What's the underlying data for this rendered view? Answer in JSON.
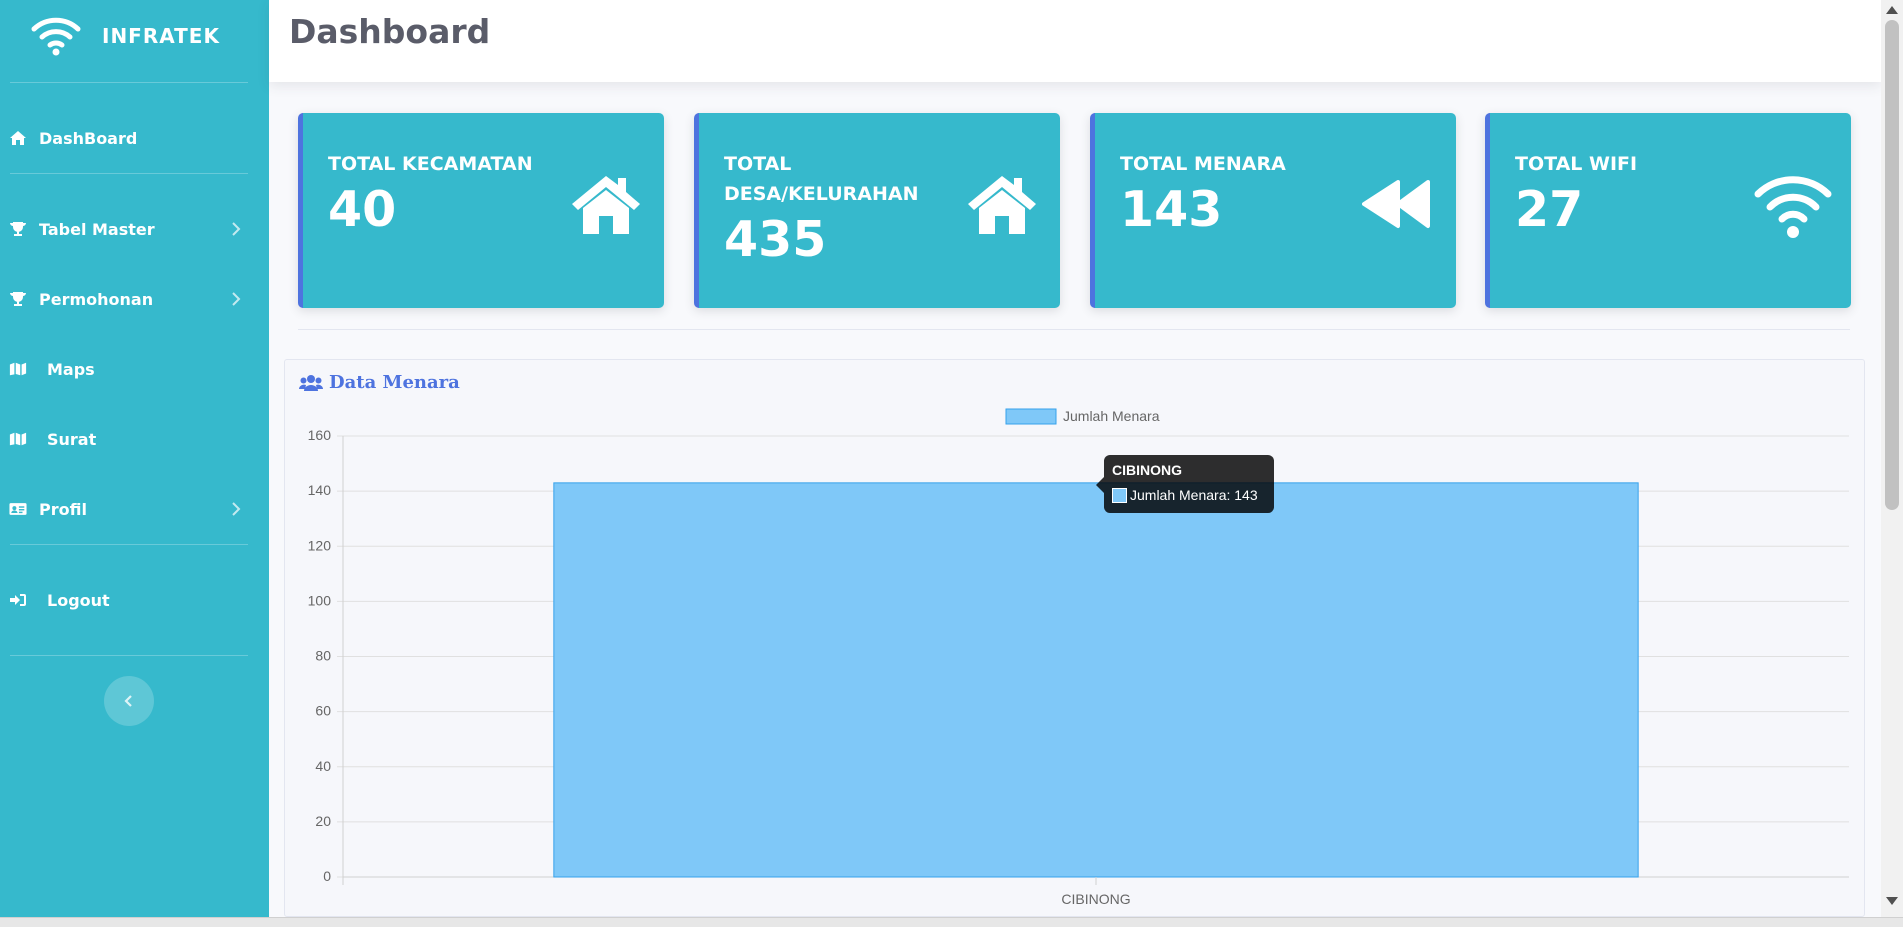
{
  "brand": {
    "name": "INFRATEK",
    "icon": "wifi-icon"
  },
  "sidebar": {
    "items": [
      {
        "label": "DashBoard",
        "icon": "home-icon"
      },
      {
        "label": "Tabel Master",
        "icon": "trophy-icon"
      },
      {
        "label": "Permohonan",
        "icon": "trophy-icon"
      },
      {
        "label": "Maps",
        "icon": "map-icon"
      },
      {
        "label": "Surat",
        "icon": "map-icon"
      },
      {
        "label": "Profil",
        "icon": "id-card-icon"
      },
      {
        "label": "Logout",
        "icon": "sign-out-icon"
      }
    ],
    "toggle_icon": "chevron-left-icon"
  },
  "header": {
    "title": "Dashboard"
  },
  "cards": [
    {
      "title": "TOTAL KECAMATAN",
      "value": "40",
      "icon": "home-icon"
    },
    {
      "title": "TOTAL DESA/KELURAHAN",
      "value": "435",
      "icon": "home-icon"
    },
    {
      "title": "TOTAL MENARA",
      "value": "143",
      "icon": "backward-icon"
    },
    {
      "title": "TOTAL WIFI",
      "value": "27",
      "icon": "wifi-icon"
    }
  ],
  "chart_section": {
    "title": "Data Menara",
    "icon": "users-icon"
  },
  "tooltip": {
    "title": "CIBINONG",
    "label": "Jumlah Menara: 143"
  },
  "colors": {
    "sidebar": "#36b9cc",
    "card_border": "#4e73df",
    "bar_fill": "#7fc8f8",
    "bar_border": "#36a2eb",
    "heading": "#4e73df"
  },
  "chart_data": {
    "type": "bar",
    "categories": [
      "CIBINONG"
    ],
    "series": [
      {
        "name": "Jumlah Menara",
        "values": [
          143
        ]
      }
    ],
    "ylim": [
      0,
      160
    ],
    "yticks": [
      0,
      20,
      40,
      60,
      80,
      100,
      120,
      140,
      160
    ],
    "grid": true,
    "legend": "top-center"
  }
}
